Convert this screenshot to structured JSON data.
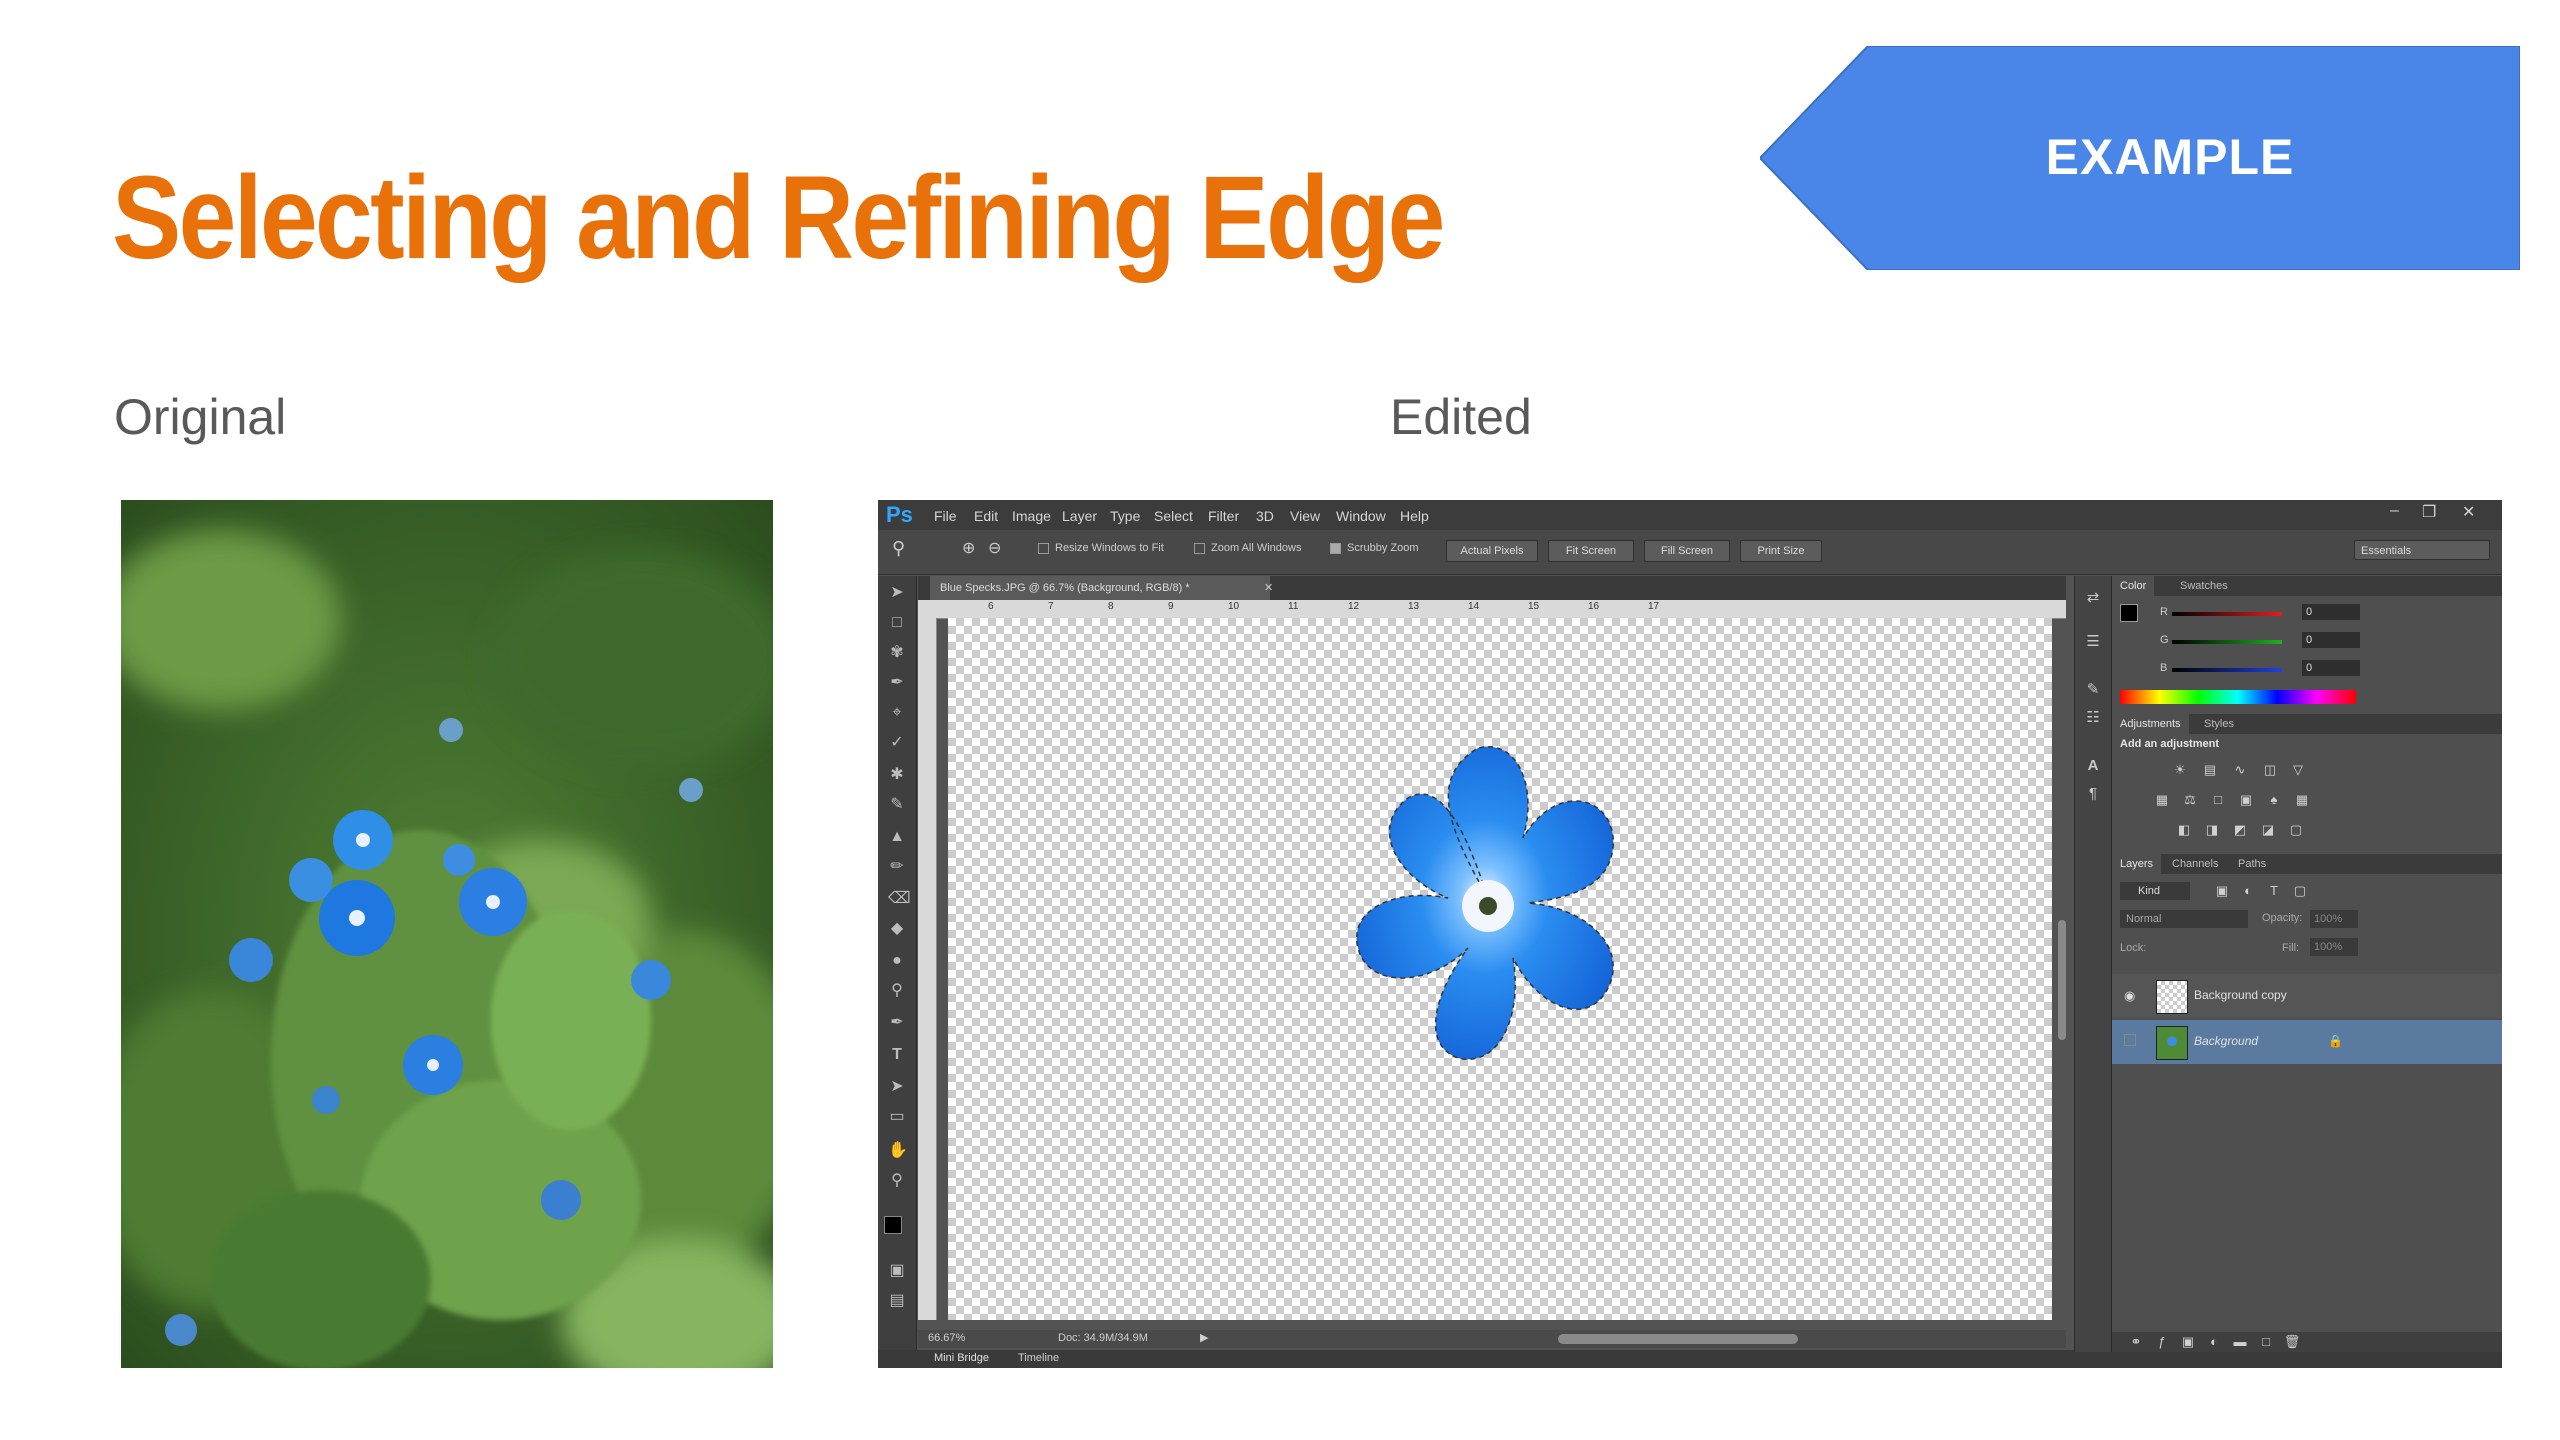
{
  "slide": {
    "title": "Selecting and Refining Edge",
    "title_color": "#e8710a",
    "banner_label": "EXAMPLE",
    "banner_color": "#4a86e8",
    "label_original": "Original",
    "label_edited": "Edited"
  },
  "photoshop": {
    "logo": "Ps",
    "menus": [
      "File",
      "Edit",
      "Image",
      "Layer",
      "Type",
      "Select",
      "Filter",
      "3D",
      "View",
      "Window",
      "Help"
    ],
    "options": {
      "resize_windows": "Resize Windows to Fit",
      "zoom_all": "Zoom All Windows",
      "scrubby_zoom": "Scrubby Zoom",
      "buttons": [
        "Actual Pixels",
        "Fit Screen",
        "Fill Screen",
        "Print Size"
      ],
      "workspace": "Essentials"
    },
    "document_tab": "Blue Specks.JPG @ 66.7% (Background, RGB/8) *",
    "ruler_numbers": [
      "6",
      "7",
      "8",
      "9",
      "10",
      "11",
      "12",
      "13",
      "14",
      "15",
      "16",
      "17"
    ],
    "status": {
      "zoom": "66.67%",
      "doc": "Doc: 34.9M/34.9M"
    },
    "bottom_tabs": [
      "Mini Bridge",
      "Timeline"
    ],
    "color_panel": {
      "tabs": [
        "Color",
        "Swatches"
      ],
      "channels": [
        {
          "label": "R",
          "value": "0",
          "color": "#e02020"
        },
        {
          "label": "G",
          "value": "0",
          "color": "#20b020"
        },
        {
          "label": "B",
          "value": "0",
          "color": "#2040e0"
        }
      ]
    },
    "adjustments_panel": {
      "tabs": [
        "Adjustments",
        "Styles"
      ],
      "heading": "Add an adjustment"
    },
    "layers_panel": {
      "tabs": [
        "Layers",
        "Channels",
        "Paths"
      ],
      "filter": "Kind",
      "blend_mode": "Normal",
      "opacity_label": "Opacity:",
      "opacity_value": "100%",
      "lock_label": "Lock:",
      "fill_label": "Fill:",
      "fill_value": "100%",
      "layers": [
        "Background copy",
        "Background"
      ]
    }
  }
}
